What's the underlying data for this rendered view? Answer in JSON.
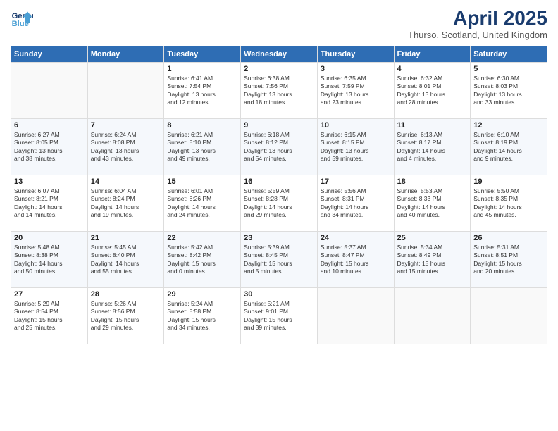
{
  "header": {
    "logo_line1": "General",
    "logo_line2": "Blue",
    "title": "April 2025",
    "subtitle": "Thurso, Scotland, United Kingdom"
  },
  "days_of_week": [
    "Sunday",
    "Monday",
    "Tuesday",
    "Wednesday",
    "Thursday",
    "Friday",
    "Saturday"
  ],
  "weeks": [
    [
      {
        "day": "",
        "info": ""
      },
      {
        "day": "",
        "info": ""
      },
      {
        "day": "1",
        "info": "Sunrise: 6:41 AM\nSunset: 7:54 PM\nDaylight: 13 hours\nand 12 minutes."
      },
      {
        "day": "2",
        "info": "Sunrise: 6:38 AM\nSunset: 7:56 PM\nDaylight: 13 hours\nand 18 minutes."
      },
      {
        "day": "3",
        "info": "Sunrise: 6:35 AM\nSunset: 7:59 PM\nDaylight: 13 hours\nand 23 minutes."
      },
      {
        "day": "4",
        "info": "Sunrise: 6:32 AM\nSunset: 8:01 PM\nDaylight: 13 hours\nand 28 minutes."
      },
      {
        "day": "5",
        "info": "Sunrise: 6:30 AM\nSunset: 8:03 PM\nDaylight: 13 hours\nand 33 minutes."
      }
    ],
    [
      {
        "day": "6",
        "info": "Sunrise: 6:27 AM\nSunset: 8:05 PM\nDaylight: 13 hours\nand 38 minutes."
      },
      {
        "day": "7",
        "info": "Sunrise: 6:24 AM\nSunset: 8:08 PM\nDaylight: 13 hours\nand 43 minutes."
      },
      {
        "day": "8",
        "info": "Sunrise: 6:21 AM\nSunset: 8:10 PM\nDaylight: 13 hours\nand 49 minutes."
      },
      {
        "day": "9",
        "info": "Sunrise: 6:18 AM\nSunset: 8:12 PM\nDaylight: 13 hours\nand 54 minutes."
      },
      {
        "day": "10",
        "info": "Sunrise: 6:15 AM\nSunset: 8:15 PM\nDaylight: 13 hours\nand 59 minutes."
      },
      {
        "day": "11",
        "info": "Sunrise: 6:13 AM\nSunset: 8:17 PM\nDaylight: 14 hours\nand 4 minutes."
      },
      {
        "day": "12",
        "info": "Sunrise: 6:10 AM\nSunset: 8:19 PM\nDaylight: 14 hours\nand 9 minutes."
      }
    ],
    [
      {
        "day": "13",
        "info": "Sunrise: 6:07 AM\nSunset: 8:21 PM\nDaylight: 14 hours\nand 14 minutes."
      },
      {
        "day": "14",
        "info": "Sunrise: 6:04 AM\nSunset: 8:24 PM\nDaylight: 14 hours\nand 19 minutes."
      },
      {
        "day": "15",
        "info": "Sunrise: 6:01 AM\nSunset: 8:26 PM\nDaylight: 14 hours\nand 24 minutes."
      },
      {
        "day": "16",
        "info": "Sunrise: 5:59 AM\nSunset: 8:28 PM\nDaylight: 14 hours\nand 29 minutes."
      },
      {
        "day": "17",
        "info": "Sunrise: 5:56 AM\nSunset: 8:31 PM\nDaylight: 14 hours\nand 34 minutes."
      },
      {
        "day": "18",
        "info": "Sunrise: 5:53 AM\nSunset: 8:33 PM\nDaylight: 14 hours\nand 40 minutes."
      },
      {
        "day": "19",
        "info": "Sunrise: 5:50 AM\nSunset: 8:35 PM\nDaylight: 14 hours\nand 45 minutes."
      }
    ],
    [
      {
        "day": "20",
        "info": "Sunrise: 5:48 AM\nSunset: 8:38 PM\nDaylight: 14 hours\nand 50 minutes."
      },
      {
        "day": "21",
        "info": "Sunrise: 5:45 AM\nSunset: 8:40 PM\nDaylight: 14 hours\nand 55 minutes."
      },
      {
        "day": "22",
        "info": "Sunrise: 5:42 AM\nSunset: 8:42 PM\nDaylight: 15 hours\nand 0 minutes."
      },
      {
        "day": "23",
        "info": "Sunrise: 5:39 AM\nSunset: 8:45 PM\nDaylight: 15 hours\nand 5 minutes."
      },
      {
        "day": "24",
        "info": "Sunrise: 5:37 AM\nSunset: 8:47 PM\nDaylight: 15 hours\nand 10 minutes."
      },
      {
        "day": "25",
        "info": "Sunrise: 5:34 AM\nSunset: 8:49 PM\nDaylight: 15 hours\nand 15 minutes."
      },
      {
        "day": "26",
        "info": "Sunrise: 5:31 AM\nSunset: 8:51 PM\nDaylight: 15 hours\nand 20 minutes."
      }
    ],
    [
      {
        "day": "27",
        "info": "Sunrise: 5:29 AM\nSunset: 8:54 PM\nDaylight: 15 hours\nand 25 minutes."
      },
      {
        "day": "28",
        "info": "Sunrise: 5:26 AM\nSunset: 8:56 PM\nDaylight: 15 hours\nand 29 minutes."
      },
      {
        "day": "29",
        "info": "Sunrise: 5:24 AM\nSunset: 8:58 PM\nDaylight: 15 hours\nand 34 minutes."
      },
      {
        "day": "30",
        "info": "Sunrise: 5:21 AM\nSunset: 9:01 PM\nDaylight: 15 hours\nand 39 minutes."
      },
      {
        "day": "",
        "info": ""
      },
      {
        "day": "",
        "info": ""
      },
      {
        "day": "",
        "info": ""
      }
    ]
  ]
}
